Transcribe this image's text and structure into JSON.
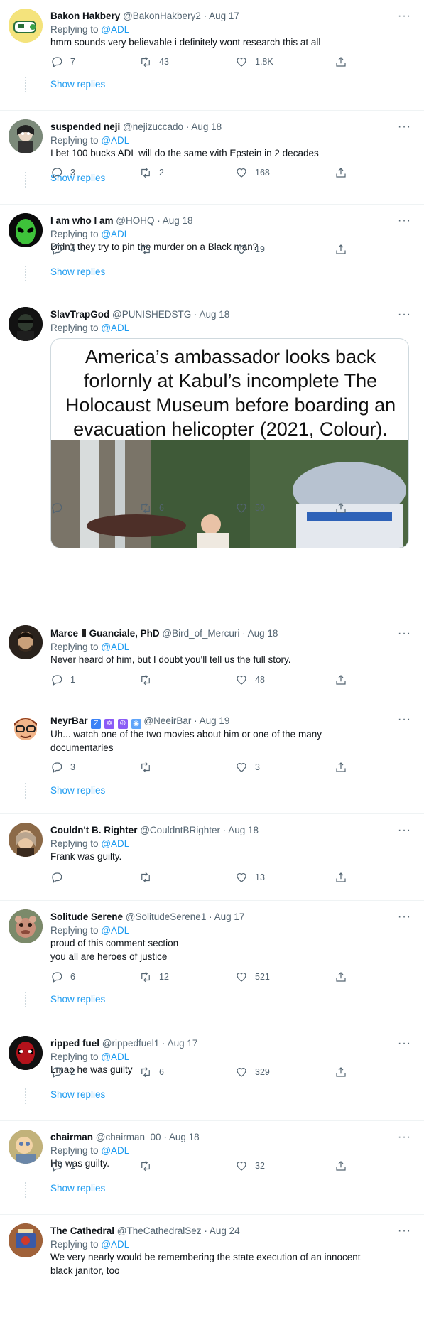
{
  "colors": {
    "accent": "#1d9bf0",
    "muted": "#536471",
    "text": "#0f1419",
    "divider": "#eff3f4"
  },
  "icons": {
    "reply": "reply-icon",
    "retweet": "retweet-icon",
    "like": "heart-icon",
    "share": "share-icon",
    "more": "more-icon"
  },
  "more_glyph": "···",
  "show_replies": "Show replies",
  "replying_prefix": "Replying to",
  "tweets": [
    {
      "name": "Bakon Hakbery",
      "handle": "@BakonHakbery2",
      "date": "· Aug 17",
      "replying_to": "@ADL",
      "text": "hmm sounds very believable i definitely wont research this at all",
      "replies": "7",
      "retweets": "43",
      "likes": "1.8K"
    },
    {
      "name": "suspended neji",
      "handle": "@nejizuccado",
      "date": "· Aug 18",
      "replying_to": "@ADL",
      "text": "I bet 100 bucks ADL will do the same with Epstein in 2 decades",
      "replies": "3",
      "retweets": "2",
      "likes": "168"
    },
    {
      "name": "I am who I am",
      "handle": "@HOHQ",
      "date": "· Aug 18",
      "replying_to": "@ADL",
      "text": "Didn't they try to pin the murder on a Black man?",
      "replies": "4",
      "retweets": "",
      "likes": "19"
    },
    {
      "name": "SlavTrapGod",
      "handle": "@PUNISHEDSTG",
      "date": "· Aug 18",
      "replying_to": "@ADL",
      "media_caption": "America’s ambassador looks back forlornly at Kabul’s incomplete The Holocaust Museum before boarding an evacuation helicopter (2021, Colour).",
      "replies": "",
      "retweets": "6",
      "likes": "50"
    },
    {
      "name": "Marce",
      "name_suffix": "Guanciale, PhD",
      "handle": "@Bird_of_Mercuri",
      "date": "· Aug 18",
      "replying_to": "@ADL",
      "text": "Never heard of him, but I doubt you'll tell us the full story.",
      "replies": "1",
      "retweets": "",
      "likes": "48"
    },
    {
      "name": "NeyrBar",
      "handle": "@NeeirBar",
      "date": "· Aug 19",
      "text_line1": "Uh... watch one of the two movies about him or one of the many",
      "text_line2": "documentaries",
      "replies": "3",
      "retweets": "",
      "likes": "3"
    },
    {
      "name": "Couldn't B. Righter",
      "handle": "@CouldntBRighter",
      "date": "· Aug 18",
      "replying_to": "@ADL",
      "text": "Frank was guilty.",
      "replies": "",
      "retweets": "",
      "likes": "13"
    },
    {
      "name": "Solitude Serene",
      "handle": "@SolitudeSerene1",
      "date": "· Aug 17",
      "replying_to": "@ADL",
      "text_line1": "proud of this comment section",
      "text_line2": "you all are heroes of justice",
      "replies": "6",
      "retweets": "12",
      "likes": "521"
    },
    {
      "name": "ripped fuel",
      "handle": "@rippedfuel1",
      "date": "· Aug 17",
      "replying_to": "@ADL",
      "text": "Lmao he was guilty",
      "replies": "2",
      "retweets": "6",
      "likes": "329"
    },
    {
      "name": "chairman",
      "handle": "@chairman_00",
      "date": "· Aug 18",
      "replying_to": "@ADL",
      "text": "He was guilty.",
      "replies": "1",
      "retweets": "",
      "likes": "32"
    },
    {
      "name": "The Cathedral",
      "handle": "@TheCathedralSez",
      "date": "· Aug 24",
      "replying_to": "@ADL",
      "text_line1": "We very nearly would be remembering the state execution of an innocent",
      "text_line2": "black janitor, too"
    }
  ]
}
